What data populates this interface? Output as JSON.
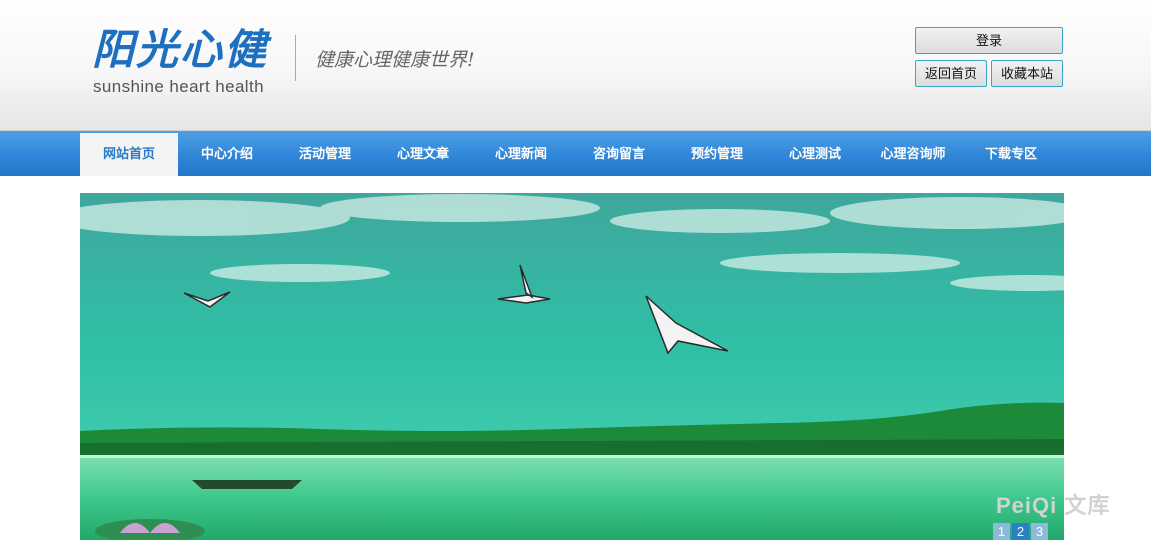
{
  "header": {
    "logo_cn": "阳光心健",
    "logo_en": "sunshine heart health",
    "slogan": "健康心理健康世界!",
    "buttons": {
      "login": "登录",
      "back_home": "返回首页",
      "bookmark": "收藏本站"
    }
  },
  "nav": {
    "items": [
      {
        "label": "网站首页",
        "active": true
      },
      {
        "label": "中心介绍"
      },
      {
        "label": "活动管理"
      },
      {
        "label": "心理文章"
      },
      {
        "label": "心理新闻"
      },
      {
        "label": "咨询留言"
      },
      {
        "label": "预约管理"
      },
      {
        "label": "心理测试"
      },
      {
        "label": "心理咨询师"
      },
      {
        "label": "下载专区"
      }
    ]
  },
  "banner": {
    "pager": [
      "1",
      "2",
      "3"
    ],
    "active_page": "2"
  },
  "watermark": "PeiQi 文库",
  "colors": {
    "nav_blue": "#2f86d8",
    "button_border": "#3aa7c6",
    "logo_blue": "#1d6fbf"
  }
}
